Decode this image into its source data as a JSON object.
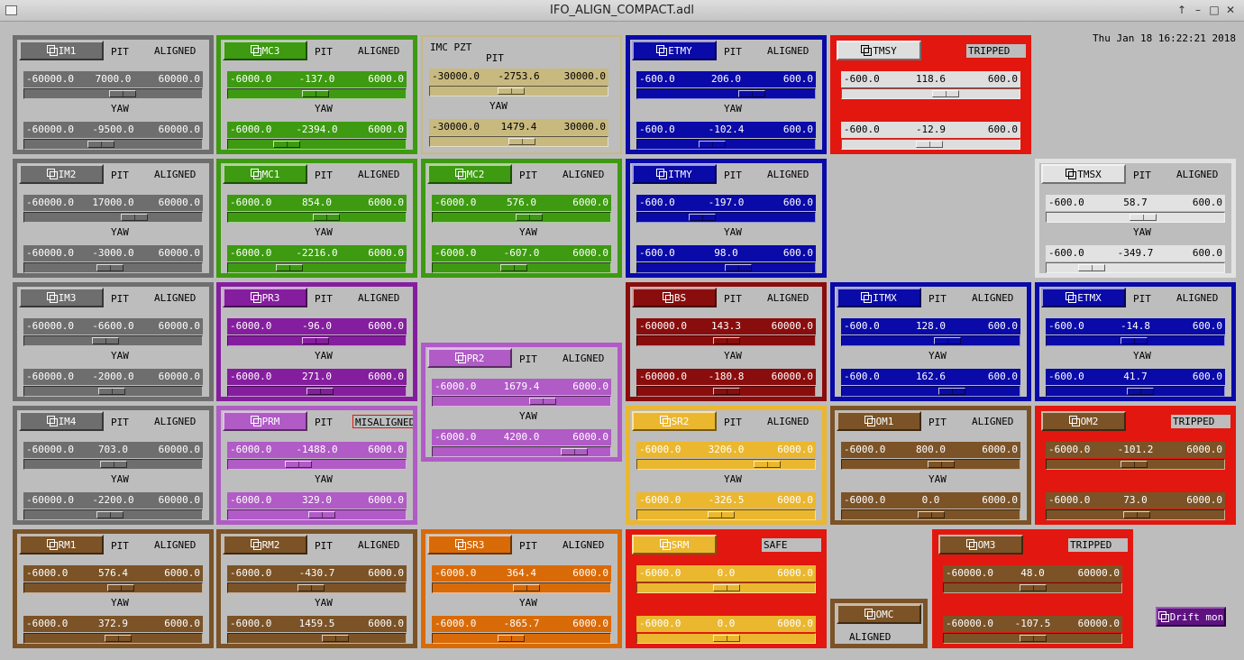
{
  "window": {
    "title": "IFO_ALIGN_COMPACT.adl"
  },
  "datetime": "Thu Jan 18 16:22:21 2018",
  "drift_button": "Drift mon",
  "labels": {
    "pit": "PIT",
    "yaw": "YAW"
  },
  "themes": {
    "gray": {
      "border": "#6e6e6e",
      "bg": "#bdbdbd",
      "btn": "#6e6e6e",
      "btnText": "#ffffff",
      "row": "#6e6e6e",
      "rowText": "#ffffff",
      "knob": "#6e6e6e"
    },
    "green": {
      "border": "#3d9a11",
      "bg": "#bdbdbd",
      "btn": "#3d9a11",
      "btnText": "#ffffff",
      "row": "#3d9a11",
      "rowText": "#ffffff",
      "knob": "#3d9a11"
    },
    "tan": {
      "border": "#c8b97e",
      "bg": "#bdbdbd",
      "btn": "#c8b97e",
      "btnText": "#000000",
      "row": "#c8b97e",
      "rowText": "#000000",
      "knob": "#c8b97e"
    },
    "blue": {
      "border": "#0a0aa8",
      "bg": "#bdbdbd",
      "btn": "#0a0aa8",
      "btnText": "#ffffff",
      "row": "#0a0aa8",
      "rowText": "#ffffff",
      "knob": "#0a0aa8"
    },
    "purple": {
      "border": "#851e9e",
      "bg": "#bdbdbd",
      "btn": "#851e9e",
      "btnText": "#ffffff",
      "row": "#851e9e",
      "rowText": "#ffffff",
      "knob": "#851e9e"
    },
    "lilac": {
      "border": "#b05bc6",
      "bg": "#bdbdbd",
      "btn": "#b05bc6",
      "btnText": "#ffffff",
      "row": "#b05bc6",
      "rowText": "#ffffff",
      "knob": "#b05bc6"
    },
    "maroon": {
      "border": "#8a0d0d",
      "bg": "#bdbdbd",
      "btn": "#8a0d0d",
      "btnText": "#ffffff",
      "row": "#8a0d0d",
      "rowText": "#ffffff",
      "knob": "#8a0d0d"
    },
    "yellow": {
      "border": "#ebb72f",
      "bg": "#bdbdbd",
      "btn": "#ebb72f",
      "btnText": "#ffffff",
      "row": "#ebb72f",
      "rowText": "#ffffff",
      "knob": "#ebb72f"
    },
    "brown": {
      "border": "#7b5327",
      "bg": "#bdbdbd",
      "btn": "#7b5327",
      "btnText": "#ffffff",
      "row": "#7b5327",
      "rowText": "#ffffff",
      "knob": "#7b5327"
    },
    "orange": {
      "border": "#d96a08",
      "bg": "#bdbdbd",
      "btn": "#d96a08",
      "btnText": "#ffffff",
      "row": "#d96a08",
      "rowText": "#ffffff",
      "knob": "#d96a08"
    },
    "white": {
      "border": "#e2e2e2",
      "bg": "#bdbdbd",
      "btn": "#e2e2e2",
      "btnText": "#000000",
      "row": "#e2e2e2",
      "rowText": "#000000",
      "knob": "#e2e2e2"
    },
    "tripped_gray": {
      "border": "#e2170f",
      "bg": "#e2170f",
      "btn": "#dedede",
      "btnText": "#000000",
      "row": "#dedede",
      "rowText": "#000000",
      "knob": "#dedede"
    },
    "tripped_brown": {
      "border": "#e2170f",
      "bg": "#e2170f",
      "btn": "#7b5327",
      "btnText": "#ffffff",
      "row": "#7b5327",
      "rowText": "#ffffff",
      "knob": "#7b5327"
    },
    "tripped_yellow": {
      "border": "#e2170f",
      "bg": "#e2170f",
      "btn": "#ebb72f",
      "btnText": "#ffffff",
      "row": "#ebb72f",
      "rowText": "#ffffff",
      "knob": "#ebb72f"
    }
  },
  "panels": [
    {
      "name": "IM1",
      "theme": "gray",
      "status": "ALIGNED",
      "pit": {
        "min": "-60000.0",
        "value": "7000.0",
        "max": "60000.0",
        "pos": 0.56
      },
      "yaw": {
        "min": "-60000.0",
        "value": "-9500.0",
        "max": "60000.0",
        "pos": 0.42
      }
    },
    {
      "name": "MC3",
      "theme": "green",
      "status": "ALIGNED",
      "pit": {
        "min": "-6000.0",
        "value": "-137.0",
        "max": "6000.0",
        "pos": 0.49
      },
      "yaw": {
        "min": "-6000.0",
        "value": "-2394.0",
        "max": "6000.0",
        "pos": 0.3
      }
    },
    {
      "name": "IMC PZT",
      "theme": "tan",
      "status": "",
      "pit": {
        "min": "-30000.0",
        "value": "-2753.6",
        "max": "30000.0",
        "pos": 0.45
      },
      "yaw": {
        "min": "-30000.0",
        "value": "1479.4",
        "max": "30000.0",
        "pos": 0.52
      }
    },
    {
      "name": "ETMY",
      "theme": "blue",
      "status": "ALIGNED",
      "pit": {
        "min": "-600.0",
        "value": "206.0",
        "max": "600.0",
        "pos": 0.67
      },
      "yaw": {
        "min": "-600.0",
        "value": "-102.4",
        "max": "600.0",
        "pos": 0.41
      }
    },
    {
      "name": "TMSY",
      "theme": "tripped_gray",
      "status": "TRIPPED",
      "pit": {
        "min": "-600.0",
        "value": "118.6",
        "max": "600.0",
        "pos": 0.6
      },
      "yaw": {
        "min": "-600.0",
        "value": "-12.9",
        "max": "600.0",
        "pos": 0.49
      }
    },
    {
      "name": "IM2",
      "theme": "gray",
      "status": "ALIGNED",
      "pit": {
        "min": "-60000.0",
        "value": "17000.0",
        "max": "60000.0",
        "pos": 0.64
      },
      "yaw": {
        "min": "-60000.0",
        "value": "-3000.0",
        "max": "60000.0",
        "pos": 0.48
      }
    },
    {
      "name": "MC1",
      "theme": "green",
      "status": "ALIGNED",
      "pit": {
        "min": "-6000.0",
        "value": "854.0",
        "max": "6000.0",
        "pos": 0.56
      },
      "yaw": {
        "min": "-6000.0",
        "value": "-2216.0",
        "max": "6000.0",
        "pos": 0.32
      }
    },
    {
      "name": "MC2",
      "theme": "green",
      "status": "ALIGNED",
      "pit": {
        "min": "-6000.0",
        "value": "576.0",
        "max": "6000.0",
        "pos": 0.55
      },
      "yaw": {
        "min": "-6000.0",
        "value": "-607.0",
        "max": "6000.0",
        "pos": 0.45
      }
    },
    {
      "name": "ITMY",
      "theme": "blue",
      "status": "ALIGNED",
      "pit": {
        "min": "-600.0",
        "value": "-197.0",
        "max": "600.0",
        "pos": 0.34
      },
      "yaw": {
        "min": "-600.0",
        "value": "98.0",
        "max": "600.0",
        "pos": 0.58
      }
    },
    {
      "name": "TMSX",
      "theme": "white",
      "status": "ALIGNED",
      "pit": {
        "min": "-600.0",
        "value": "58.7",
        "max": "600.0",
        "pos": 0.55
      },
      "yaw": {
        "min": "-600.0",
        "value": "-349.7",
        "max": "600.0",
        "pos": 0.21
      }
    },
    {
      "name": "IM3",
      "theme": "gray",
      "status": "ALIGNED",
      "pit": {
        "min": "-60000.0",
        "value": "-6600.0",
        "max": "60000.0",
        "pos": 0.45
      },
      "yaw": {
        "min": "-60000.0",
        "value": "-2000.0",
        "max": "60000.0",
        "pos": 0.49
      }
    },
    {
      "name": "PR3",
      "theme": "purple",
      "status": "ALIGNED",
      "pit": {
        "min": "-6000.0",
        "value": "-96.0",
        "max": "6000.0",
        "pos": 0.49
      },
      "yaw": {
        "min": "-6000.0",
        "value": "271.0",
        "max": "6000.0",
        "pos": 0.52
      }
    },
    {
      "name": "PR2",
      "theme": "lilac",
      "status": "ALIGNED",
      "pit": {
        "min": "-6000.0",
        "value": "1679.4",
        "max": "6000.0",
        "pos": 0.64
      },
      "yaw": {
        "min": "-6000.0",
        "value": "4200.0",
        "max": "6000.0",
        "pos": 0.85
      }
    },
    {
      "name": "BS",
      "theme": "maroon",
      "status": "ALIGNED",
      "pit": {
        "min": "-60000.0",
        "value": "143.3",
        "max": "60000.0",
        "pos": 0.5
      },
      "yaw": {
        "min": "-60000.0",
        "value": "-180.8",
        "max": "60000.0",
        "pos": 0.5
      }
    },
    {
      "name": "ITMX",
      "theme": "blue",
      "status": "ALIGNED",
      "pit": {
        "min": "-600.0",
        "value": "128.0",
        "max": "600.0",
        "pos": 0.61
      },
      "yaw": {
        "min": "-600.0",
        "value": "162.6",
        "max": "600.0",
        "pos": 0.64
      }
    },
    {
      "name": "ETMX",
      "theme": "blue",
      "status": "ALIGNED",
      "pit": {
        "min": "-600.0",
        "value": "-14.8",
        "max": "600.0",
        "pos": 0.49
      },
      "yaw": {
        "min": "-600.0",
        "value": "41.7",
        "max": "600.0",
        "pos": 0.53
      }
    },
    {
      "name": "IM4",
      "theme": "gray",
      "status": "ALIGNED",
      "pit": {
        "min": "-60000.0",
        "value": "703.0",
        "max": "60000.0",
        "pos": 0.5
      },
      "yaw": {
        "min": "-60000.0",
        "value": "-2200.0",
        "max": "60000.0",
        "pos": 0.48
      }
    },
    {
      "name": "PRM",
      "theme": "lilac",
      "status": "MISALIGNED",
      "pit": {
        "min": "-6000.0",
        "value": "-1488.0",
        "max": "6000.0",
        "pos": 0.38
      },
      "yaw": {
        "min": "-6000.0",
        "value": "329.0",
        "max": "6000.0",
        "pos": 0.53
      }
    },
    {
      "name": "SR2",
      "theme": "yellow",
      "status": "ALIGNED",
      "pit": {
        "min": "-6000.0",
        "value": "3206.0",
        "max": "6000.0",
        "pos": 0.77
      },
      "yaw": {
        "min": "-6000.0",
        "value": "-326.5",
        "max": "6000.0",
        "pos": 0.47
      }
    },
    {
      "name": "OM1",
      "theme": "brown",
      "status": "ALIGNED",
      "pit": {
        "min": "-6000.0",
        "value": "800.0",
        "max": "6000.0",
        "pos": 0.57
      },
      "yaw": {
        "min": "-6000.0",
        "value": "0.0",
        "max": "6000.0",
        "pos": 0.5
      }
    },
    {
      "name": "OM2",
      "theme": "tripped_brown",
      "status": "TRIPPED",
      "pit": {
        "min": "-6000.0",
        "value": "-101.2",
        "max": "6000.0",
        "pos": 0.49
      },
      "yaw": {
        "min": "-6000.0",
        "value": "73.0",
        "max": "6000.0",
        "pos": 0.51
      }
    },
    {
      "name": "RM1",
      "theme": "brown",
      "status": "ALIGNED",
      "pit": {
        "min": "-6000.0",
        "value": "576.4",
        "max": "6000.0",
        "pos": 0.55
      },
      "yaw": {
        "min": "-6000.0",
        "value": "372.9",
        "max": "6000.0",
        "pos": 0.53
      }
    },
    {
      "name": "RM2",
      "theme": "brown",
      "status": "ALIGNED",
      "pit": {
        "min": "-6000.0",
        "value": "-430.7",
        "max": "6000.0",
        "pos": 0.46
      },
      "yaw": {
        "min": "-6000.0",
        "value": "1459.5",
        "max": "6000.0",
        "pos": 0.62
      }
    },
    {
      "name": "SR3",
      "theme": "orange",
      "status": "ALIGNED",
      "pit": {
        "min": "-6000.0",
        "value": "364.4",
        "max": "6000.0",
        "pos": 0.53
      },
      "yaw": {
        "min": "-6000.0",
        "value": "-865.7",
        "max": "6000.0",
        "pos": 0.43
      }
    },
    {
      "name": "SRM",
      "theme": "tripped_yellow",
      "status": "SAFE",
      "pit": {
        "min": "-6000.0",
        "value": "0.0",
        "max": "6000.0",
        "pos": 0.5
      },
      "yaw": {
        "min": "-6000.0",
        "value": "0.0",
        "max": "6000.0",
        "pos": 0.5
      }
    },
    {
      "name": "OM3",
      "theme": "tripped_brown",
      "status": "TRIPPED",
      "pit": {
        "min": "-60000.0",
        "value": "48.0",
        "max": "60000.0",
        "pos": 0.5
      },
      "yaw": {
        "min": "-60000.0",
        "value": "-107.5",
        "max": "60000.0",
        "pos": 0.5
      }
    }
  ],
  "omc": {
    "name": "OMC",
    "status": "ALIGNED",
    "theme": "brown"
  }
}
